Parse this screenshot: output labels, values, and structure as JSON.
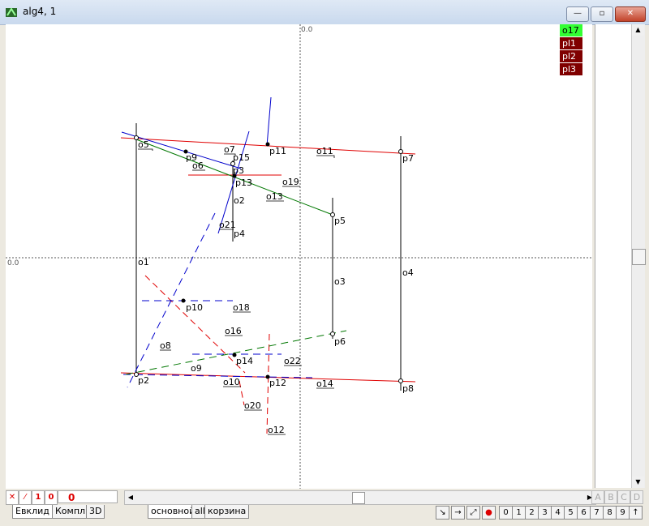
{
  "window": {
    "title": "alg4, 1",
    "controls": {
      "minimize": "—",
      "maximize": "▫",
      "close": "✕"
    }
  },
  "axes": {
    "x_label": "0.0",
    "y_label": "0.0"
  },
  "legend": [
    "o17",
    "pl1",
    "pl2",
    "pl3"
  ],
  "point_labels": [
    "p6",
    "p9",
    "p3",
    "p15",
    "p13",
    "p11",
    "p7",
    "p5",
    "p4",
    "p10",
    "p14",
    "p12",
    "p2",
    "p6",
    "p8"
  ],
  "object_labels": [
    "o5",
    "o7",
    "o6",
    "o11",
    "o19",
    "o13",
    "o2",
    "o21",
    "o1",
    "o3",
    "o4",
    "o18",
    "o16",
    "o8",
    "o22",
    "o9",
    "o10",
    "o14",
    "o20",
    "o12"
  ],
  "status": {
    "icons": [
      "✕",
      "⁄",
      "1",
      "0"
    ],
    "counter": "0"
  },
  "abcd": [
    "A",
    "B",
    "C",
    "D"
  ],
  "tabs_left": [
    "Евклид",
    "Компл.",
    "3D"
  ],
  "tabs_right": [
    "основной",
    "all",
    "корзина"
  ],
  "tools": [
    "↘",
    "→",
    "⤢",
    "●"
  ],
  "digits": [
    "0",
    "1",
    "2",
    "3",
    "4",
    "5",
    "6",
    "7",
    "8",
    "9",
    "↑"
  ]
}
